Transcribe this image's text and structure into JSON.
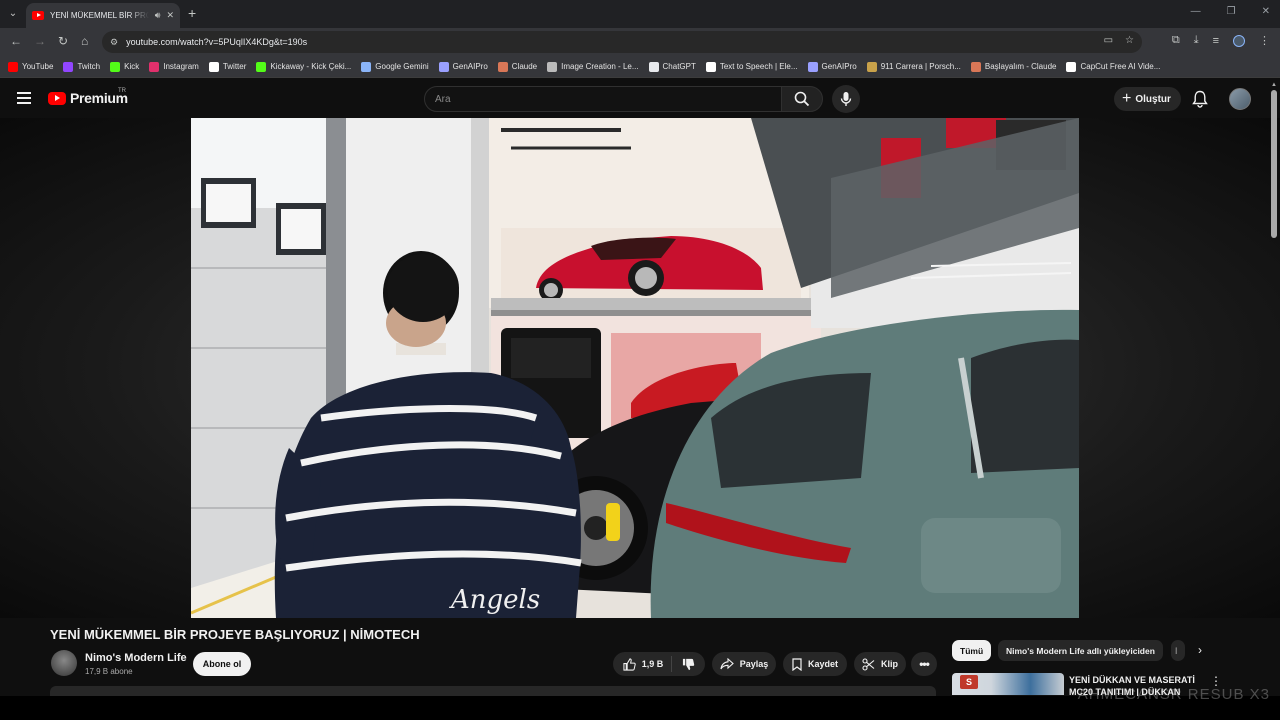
{
  "browser": {
    "tab_title": "YENİ MÜKEMMEL BİR PROJEYE BAŞLIYORUZ | NİMOTECH",
    "url": "youtube.com/watch?v=5PUqlIX4KDg&t=190s",
    "bookmarks": [
      {
        "label": "YouTube",
        "color": "#ff0000"
      },
      {
        "label": "Twitch",
        "color": "#9146ff"
      },
      {
        "label": "Kick",
        "color": "#53fc18"
      },
      {
        "label": "Instagram",
        "color": "#e1306c"
      },
      {
        "label": "Twitter",
        "color": "#ffffff"
      },
      {
        "label": "Kickaway - Kick Çeki...",
        "color": "#53fc18"
      },
      {
        "label": "Google Gemini",
        "color": "#8ab4f8"
      },
      {
        "label": "GenAIPro",
        "color": "#9aa0ff"
      },
      {
        "label": "Claude",
        "color": "#d97757"
      },
      {
        "label": "Image Creation - Le...",
        "color": "#bbbbbb"
      },
      {
        "label": "ChatGPT",
        "color": "#e8eaed"
      },
      {
        "label": "Text to Speech | Ele...",
        "color": "#ffffff"
      },
      {
        "label": "GenAIPro",
        "color": "#9aa0ff"
      },
      {
        "label": "911 Carrera | Porsch...",
        "color": "#c9a24a"
      },
      {
        "label": "Başlayalım - Claude",
        "color": "#d97757"
      },
      {
        "label": "CapCut Free AI Vide...",
        "color": "#ffffff"
      }
    ]
  },
  "header": {
    "logo_text": "Premium",
    "country": "TR",
    "search_placeholder": "Ara",
    "create_label": "Oluştur"
  },
  "video": {
    "title": "YENİ MÜKEMMEL BİR PROJEYE BAŞLIYORUZ | NİMOTECH",
    "channel_name": "Nimo's Modern Life",
    "subscribers": "17,9 B abone",
    "subscribe_label": "Abone ol",
    "likes": "1,9 B",
    "share_label": "Paylaş",
    "save_label": "Kaydet",
    "clip_label": "Klip"
  },
  "sidebar": {
    "chips": [
      "Tümü",
      "Nimo's Modern Life adlı yükleyiciden",
      "İ"
    ],
    "rec_title": "YENİ DÜKKAN VE MASERATİ MC20 TANITIMI | DÜKKAN"
  },
  "watermark": "AHMECANSR RESUB X3"
}
